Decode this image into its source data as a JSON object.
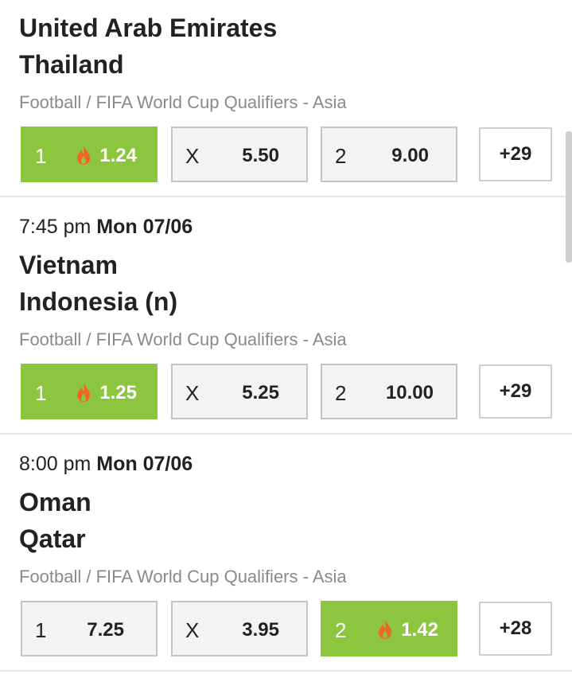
{
  "matches": [
    {
      "time": "",
      "date": "",
      "home": "United Arab Emirates",
      "away": "Thailand",
      "league": "Football / FIFA World Cup Qualifiers - Asia",
      "odds": [
        {
          "label": "1",
          "value": "1.24",
          "hot": true,
          "selected": true
        },
        {
          "label": "X",
          "value": "5.50",
          "hot": false,
          "selected": false
        },
        {
          "label": "2",
          "value": "9.00",
          "hot": false,
          "selected": false
        }
      ],
      "more": "+29"
    },
    {
      "time": "7:45 pm",
      "date": "Mon 07/06",
      "home": "Vietnam",
      "away": "Indonesia (n)",
      "league": "Football / FIFA World Cup Qualifiers - Asia",
      "odds": [
        {
          "label": "1",
          "value": "1.25",
          "hot": true,
          "selected": true
        },
        {
          "label": "X",
          "value": "5.25",
          "hot": false,
          "selected": false
        },
        {
          "label": "2",
          "value": "10.00",
          "hot": false,
          "selected": false
        }
      ],
      "more": "+29"
    },
    {
      "time": "8:00 pm",
      "date": "Mon 07/06",
      "home": "Oman",
      "away": "Qatar",
      "league": "Football / FIFA World Cup Qualifiers - Asia",
      "odds": [
        {
          "label": "1",
          "value": "7.25",
          "hot": false,
          "selected": false
        },
        {
          "label": "X",
          "value": "3.95",
          "hot": false,
          "selected": false
        },
        {
          "label": "2",
          "value": "1.42",
          "hot": true,
          "selected": true
        }
      ],
      "more": "+28"
    }
  ],
  "colors": {
    "accent": "#8cc63f",
    "flame": "#f26522"
  }
}
